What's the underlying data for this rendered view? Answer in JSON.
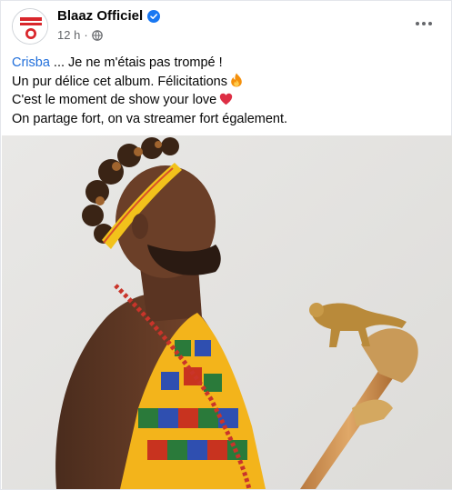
{
  "post": {
    "author": "Blaaz Officiel",
    "time": "12 h",
    "separator": "·",
    "mention": "Crisba",
    "line1_rest": " ... Je ne m'étais pas trompé !",
    "line2": "Un pur délice cet album. Félicitations",
    "line3": "C'est le moment de show your love",
    "line4": "On partage fort, on va streamer fort également."
  },
  "icons": {
    "verified": "verified-badge-icon",
    "globe": "globe-icon",
    "more": "more-options-icon",
    "fire": "fire-emoji",
    "heart": "red-heart-emoji"
  },
  "colors": {
    "link": "#216fdb",
    "meta": "#65676b",
    "verified": "#1877f2",
    "photo_bg": "#e6e5e3"
  }
}
